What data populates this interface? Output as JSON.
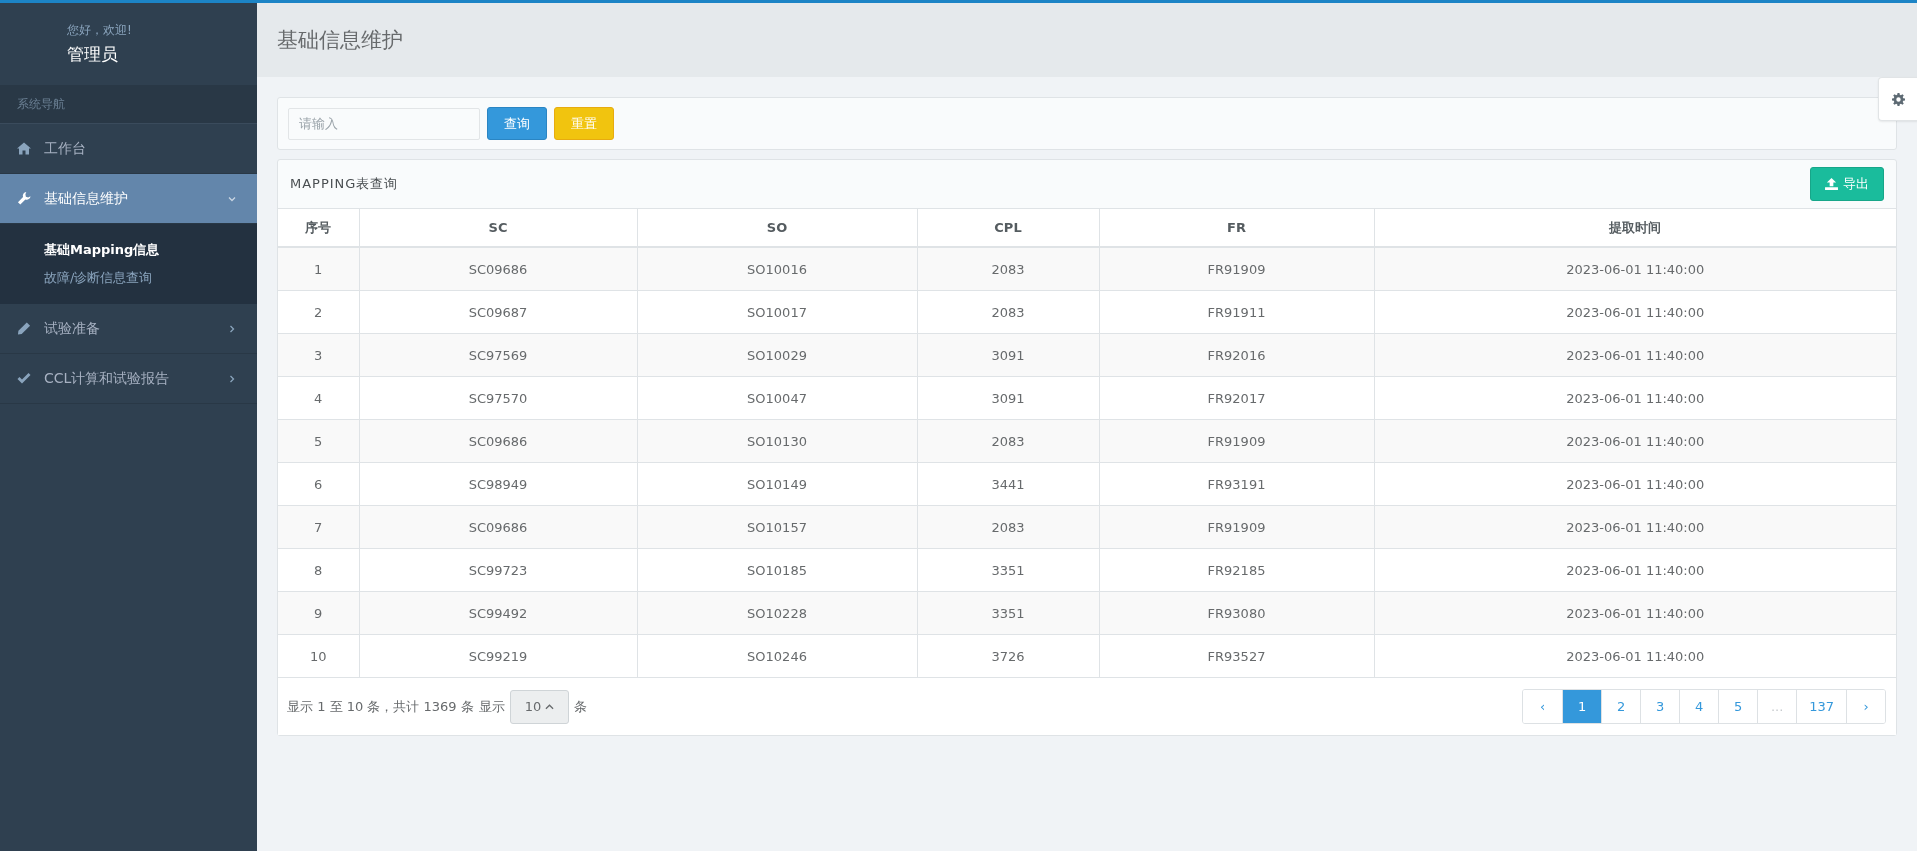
{
  "user": {
    "greeting": "您好，欢迎!",
    "name": "管理员"
  },
  "sidebar": {
    "section_title": "系统导航",
    "items": [
      {
        "kind": "link",
        "label": "工作台",
        "selected": false
      },
      {
        "kind": "menu",
        "label": "基础信息维护",
        "selected": true,
        "expanded": true,
        "children": [
          {
            "label": "基础Mapping信息",
            "selected": true
          },
          {
            "label": "故障/诊断信息查询",
            "selected": false
          }
        ]
      },
      {
        "kind": "menu",
        "label": "试验准备",
        "selected": false,
        "expanded": false
      },
      {
        "kind": "menu",
        "label": "CCL计算和试验报告",
        "selected": false,
        "expanded": false
      }
    ]
  },
  "page_title": "基础信息维护",
  "search": {
    "placeholder": "请输入",
    "buttons": [
      "查询",
      "重置"
    ]
  },
  "table_panel": {
    "title": "MAPPING表查询",
    "export_button": "导出"
  },
  "table": {
    "columns": [
      "序号",
      "SC",
      "SO",
      "CPL",
      "FR",
      "提取时间"
    ],
    "rows": [
      [
        "1",
        "SC09686",
        "SO10016",
        "2083",
        "FR91909",
        "2023-06-01 11:40:00"
      ],
      [
        "2",
        "SC09687",
        "SO10017",
        "2083",
        "FR91911",
        "2023-06-01 11:40:00"
      ],
      [
        "3",
        "SC97569",
        "SO10029",
        "3091",
        "FR92016",
        "2023-06-01 11:40:00"
      ],
      [
        "4",
        "SC97570",
        "SO10047",
        "3091",
        "FR92017",
        "2023-06-01 11:40:00"
      ],
      [
        "5",
        "SC09686",
        "SO10130",
        "2083",
        "FR91909",
        "2023-06-01 11:40:00"
      ],
      [
        "6",
        "SC98949",
        "SO10149",
        "3441",
        "FR93191",
        "2023-06-01 11:40:00"
      ],
      [
        "7",
        "SC09686",
        "SO10157",
        "2083",
        "FR91909",
        "2023-06-01 11:40:00"
      ],
      [
        "8",
        "SC99723",
        "SO10185",
        "3351",
        "FR92185",
        "2023-06-01 11:40:00"
      ],
      [
        "9",
        "SC99492",
        "SO10228",
        "3351",
        "FR93080",
        "2023-06-01 11:40:00"
      ],
      [
        "10",
        "SC99219",
        "SO10246",
        "3726",
        "FR93527",
        "2023-06-01 11:40:00"
      ]
    ]
  },
  "footer": {
    "summary": "显示 1 至 10 条，共计 1369 条",
    "show_label": "显示",
    "page_size": "10",
    "size_suffix": "条"
  },
  "pagination": [
    {
      "label": "‹",
      "selected": false,
      "disabled": false
    },
    {
      "label": "1",
      "selected": true,
      "disabled": false
    },
    {
      "label": "2",
      "selected": false,
      "disabled": false
    },
    {
      "label": "3",
      "selected": false,
      "disabled": false
    },
    {
      "label": "4",
      "selected": false,
      "disabled": false
    },
    {
      "label": "5",
      "selected": false,
      "disabled": false
    },
    {
      "label": "...",
      "selected": false,
      "disabled": true
    },
    {
      "label": "137",
      "selected": false,
      "disabled": false
    },
    {
      "label": "›",
      "selected": false,
      "disabled": false
    }
  ]
}
